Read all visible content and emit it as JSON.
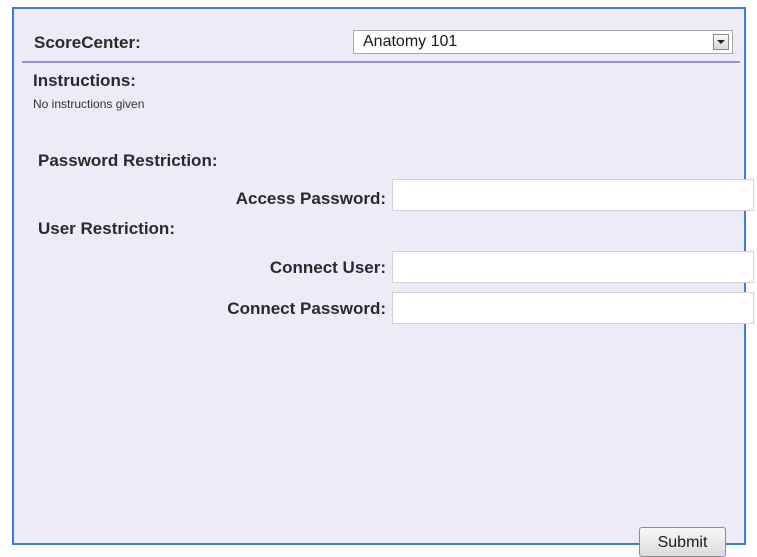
{
  "header": {
    "label": "ScoreCenter:",
    "selected_course": "Anatomy 101"
  },
  "instructions": {
    "title": "Instructions:",
    "text": "No instructions given"
  },
  "password_restriction": {
    "title": "Password Restriction:",
    "access_password_label": "Access Password:",
    "access_password_value": ""
  },
  "user_restriction": {
    "title": "User Restriction:",
    "connect_user_label": "Connect User:",
    "connect_user_value": "",
    "connect_password_label": "Connect Password:",
    "connect_password_value": ""
  },
  "actions": {
    "submit_label": "Submit"
  },
  "colors": {
    "panel_background": "#efeaf8",
    "panel_border": "#3c7fd1",
    "header_underline": "#9f8ed6"
  }
}
